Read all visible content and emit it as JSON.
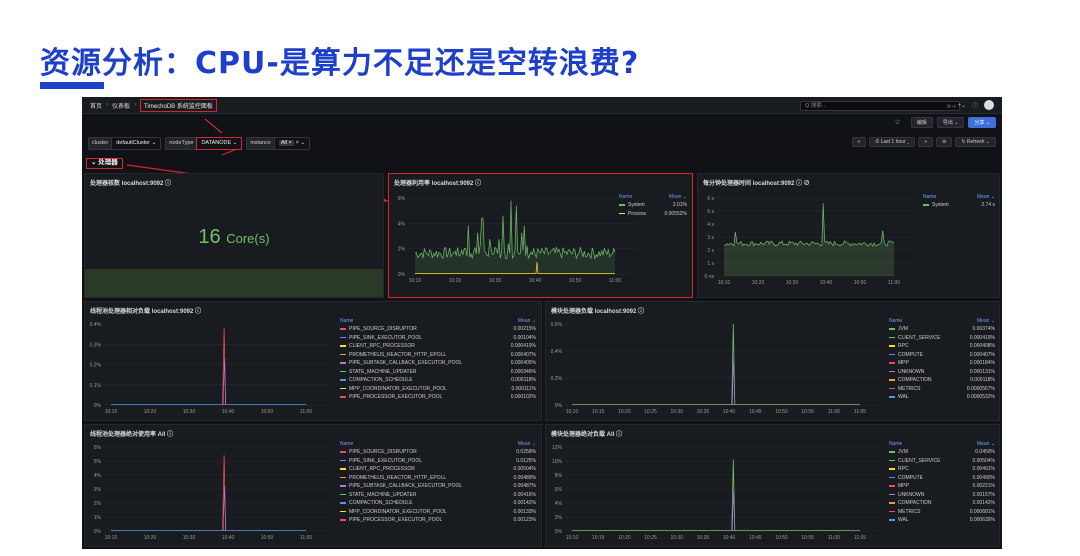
{
  "slide": {
    "title": "资源分析：CPU-是算力不足还是空转浪费?"
  },
  "colors": {
    "green": "#73bf69",
    "yellow": "#fade2a",
    "blue": "#5794f2",
    "red": "#d9242b"
  },
  "topbar": {
    "crumbs": [
      "首页",
      "仪表板",
      "TimechoDB 系统监控面板"
    ],
    "search_placeholder": "Q 搜索...",
    "search_kbd": "⌘+k"
  },
  "toolbar": {
    "star": "☆",
    "edit": "编辑",
    "export": "导出 ⌄",
    "share": "分享 ⌄"
  },
  "variables": {
    "cluster_label": "cluster",
    "cluster_value": "defaultCluster ⌄",
    "node_label": "nodeType",
    "node_value": "DATANODE ⌄",
    "instance_label": "instance",
    "instance_chip": "All ×",
    "instance_x": "× ⌄"
  },
  "timectl": {
    "back": "«",
    "range": "⏱ Last 1 hour ⌄",
    "fwd": "»",
    "zoom": "⊖",
    "refresh": "↻ Refresh ⌄"
  },
  "row_header": "⌄ 处理器",
  "panels": {
    "cores": {
      "title": "处理器核数 localhost:9092 ⓘ",
      "value": "16",
      "unit": "Core(s)"
    },
    "cpu_util": {
      "title": "处理器利用率 localhost:9092 ⓘ",
      "legend_name": "Name",
      "legend_mean": "Mean ⌄",
      "rows": [
        {
          "name": "System",
          "mean": "2.01%",
          "color": "#73bf69"
        },
        {
          "name": "Process",
          "mean": "0.00552%",
          "color": "#fade2a"
        }
      ],
      "y_ticks": [
        "6%",
        "4%",
        "2%",
        "0%"
      ],
      "x_ticks": [
        "10:10",
        "10:20",
        "10:30",
        "10:40",
        "10:50",
        "11:00"
      ]
    },
    "cpu_time": {
      "title": "每分钟处理器时间 localhost:9092 ⓘ ⊘",
      "legend_name": "Name",
      "legend_mean": "Mean ⌄",
      "rows": [
        {
          "name": "System",
          "mean": "2.74 s",
          "color": "#73bf69"
        }
      ],
      "y_ticks": [
        "6 s",
        "5 s",
        "4 s",
        "3 s",
        "2 s",
        "1 s",
        "0 ns"
      ],
      "x_ticks": [
        "10:10",
        "10:20",
        "10:30",
        "10:40",
        "10:50",
        "11:00"
      ]
    },
    "thread_load": {
      "title": "线程池处理器相对负载 localhost:9092 ⓘ",
      "legend_name": "Name",
      "legend_mean": "Mean ⌄",
      "y_ticks": [
        "0.4%",
        "0.3%",
        "0.2%",
        "0.1%",
        "0%"
      ],
      "x_ticks": [
        "10:10",
        "10:20",
        "10:30",
        "10:40",
        "10:50",
        "11:00"
      ],
      "rows": [
        {
          "name": "PIPE_SOURCE_DISRUPTOR",
          "mean": "0.00215%",
          "color": "#f2495c"
        },
        {
          "name": "PIPE_SINK_EXECUTOR_POOL",
          "mean": "0.00104%",
          "color": "#5794f2"
        },
        {
          "name": "CLIENT_RPC_PROCESSOR",
          "mean": "0.000419%",
          "color": "#fade2a"
        },
        {
          "name": "PROMETHEUS_REACTOR_HTTP_EPOLL",
          "mean": "0.000407%",
          "color": "#ff9830"
        },
        {
          "name": "PIPE_SUBTASK_CALLBACK_EXECUTOR_POOL",
          "mean": "0.000405%",
          "color": "#b877d9"
        },
        {
          "name": "STATE_MACHINE_UPDATER",
          "mean": "0.000346%",
          "color": "#73bf69"
        },
        {
          "name": "COMPACTION_SCHEDULE",
          "mean": "0.000118%",
          "color": "#5794f2"
        },
        {
          "name": "MPP_COORDINATOR_EXECUTOR_POOL",
          "mean": "0.000111%",
          "color": "#fade2a"
        },
        {
          "name": "PIPE_PROCESSOR_EXECUTOR_POOL",
          "mean": "0.000102%",
          "color": "#f2495c"
        }
      ]
    },
    "module_load": {
      "title": "模块处理器负载 localhost:9092 ⓘ",
      "legend_name": "Name",
      "legend_mean": "Mean ⌄",
      "y_ticks": [
        "0.6%",
        "0.4%",
        "0.2%",
        "0%"
      ],
      "x_ticks": [
        "10:10",
        "10:15",
        "10:20",
        "10:25",
        "10:30",
        "10:35",
        "10:40",
        "10:45",
        "10:50",
        "10:55",
        "11:00",
        "11:05"
      ],
      "rows": [
        {
          "name": "JVM",
          "mean": "0.00374%",
          "color": "#73bf69"
        },
        {
          "name": "CLIENT_SERVICE",
          "mean": "0.000419%",
          "color": "#73bf69"
        },
        {
          "name": "RPC",
          "mean": "0.000408%",
          "color": "#fade2a"
        },
        {
          "name": "COMPUTE",
          "mean": "0.000407%",
          "color": "#5794f2"
        },
        {
          "name": "MPP",
          "mean": "0.000184%",
          "color": "#f2495c"
        },
        {
          "name": "UNKNOWN",
          "mean": "0.000131%",
          "color": "#b877d9"
        },
        {
          "name": "COMPACTION",
          "mean": "0.000118%",
          "color": "#ff9830"
        },
        {
          "name": "METRICS",
          "mean": "0.0000567%",
          "color": "#f2495c"
        },
        {
          "name": "WAL",
          "mean": "0.0000532%",
          "color": "#5794f2"
        }
      ]
    },
    "thread_abs": {
      "title": "线程池处理器绝对使用率 All ⓘ",
      "legend_name": "Name",
      "legend_mean": "Mean ⌄",
      "y_ticks": [
        "6%",
        "5%",
        "4%",
        "3%",
        "2%",
        "1%",
        "0%"
      ],
      "x_ticks": [
        "10:10",
        "10:20",
        "10:30",
        "10:40",
        "10:50",
        "11:00"
      ],
      "rows": [
        {
          "name": "PIPE_SOURCE_DISRUPTOR",
          "mean": "0.0258%",
          "color": "#f2495c"
        },
        {
          "name": "PIPE_SINK_EXECUTOR_POOL",
          "mean": "0.0125%",
          "color": "#5794f2"
        },
        {
          "name": "CLIENT_RPC_PROCESSOR",
          "mean": "0.00504%",
          "color": "#fade2a"
        },
        {
          "name": "PROMETHEUS_REACTOR_HTTP_EPOLL",
          "mean": "0.00489%",
          "color": "#ff9830"
        },
        {
          "name": "PIPE_SUBTASK_CALLBACK_EXECUTOR_POOL",
          "mean": "0.00487%",
          "color": "#b877d9"
        },
        {
          "name": "STATE_MACHINE_UPDATER",
          "mean": "0.00416%",
          "color": "#73bf69"
        },
        {
          "name": "COMPACTION_SCHEDULE",
          "mean": "0.00142%",
          "color": "#5794f2"
        },
        {
          "name": "MPP_COORDINATOR_EXECUTOR_POOL",
          "mean": "0.00133%",
          "color": "#fade2a"
        },
        {
          "name": "PIPE_PROCESSOR_EXECUTOR_POOL",
          "mean": "0.00123%",
          "color": "#f2495c"
        }
      ]
    },
    "module_abs": {
      "title": "模块处理器绝对负载 All ⓘ",
      "legend_name": "Name",
      "legend_mean": "Mean ⌄",
      "y_ticks": [
        "12%",
        "10%",
        "8%",
        "6%",
        "4%",
        "2%",
        "0%"
      ],
      "x_ticks": [
        "10:10",
        "10:15",
        "10:20",
        "10:25",
        "10:30",
        "10:35",
        "10:40",
        "10:45",
        "10:50",
        "10:55",
        "11:00",
        "11:05"
      ],
      "rows": [
        {
          "name": "JVM",
          "mean": "0.0450%",
          "color": "#73bf69"
        },
        {
          "name": "CLIENT_SERVICE",
          "mean": "0.00504%",
          "color": "#73bf69"
        },
        {
          "name": "RPC",
          "mean": "0.00491%",
          "color": "#fade2a"
        },
        {
          "name": "COMPUTE",
          "mean": "0.00490%",
          "color": "#5794f2"
        },
        {
          "name": "MPP",
          "mean": "0.00221%",
          "color": "#f2495c"
        },
        {
          "name": "UNKNOWN",
          "mean": "0.00157%",
          "color": "#b877d9"
        },
        {
          "name": "COMPACTION",
          "mean": "0.00142%",
          "color": "#ff9830"
        },
        {
          "name": "METRICS",
          "mean": "0.000681%",
          "color": "#f2495c"
        },
        {
          "name": "WAL",
          "mean": "0.000639%",
          "color": "#5794f2"
        }
      ]
    }
  }
}
